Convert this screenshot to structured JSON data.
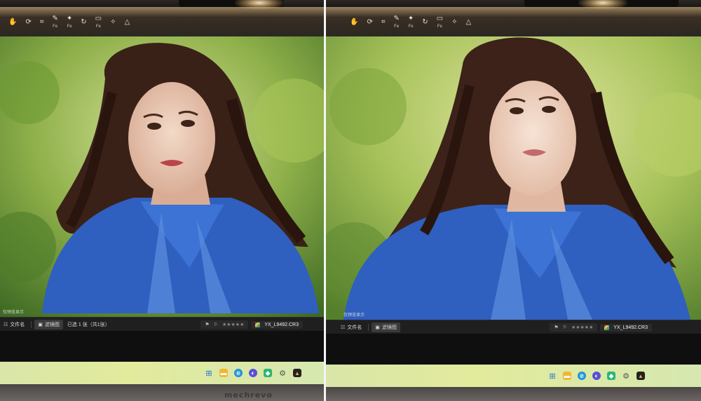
{
  "toolbar_icons": [
    {
      "icon": "hand-icon",
      "caption": ""
    },
    {
      "icon": "rotate-icon",
      "caption": ""
    },
    {
      "icon": "crop-icon",
      "caption": ""
    },
    {
      "icon": "brush-icon",
      "caption": "Fe"
    },
    {
      "icon": "wand-icon",
      "caption": "Fe"
    },
    {
      "icon": "history-icon",
      "caption": ""
    },
    {
      "icon": "frame-icon",
      "caption": "Fe"
    },
    {
      "icon": "sparkle-icon",
      "caption": ""
    },
    {
      "icon": "triangle-icon",
      "caption": ""
    }
  ],
  "overlay_hint": "仅预览显示",
  "status": {
    "filmstrip_label": "文件名",
    "tab_label": "滤镜图",
    "selection_info": "已选 1 张（共1张）",
    "rating_stars": 5,
    "filename": "YX_L9492.CR3"
  },
  "taskbar_icons": [
    "windows-start-icon",
    "folder-icon",
    "edge-icon",
    "purple-app-icon",
    "green-app-icon",
    "settings-icon",
    "photo-app-icon"
  ],
  "bezel_brand": "mechrevo",
  "colors": {
    "toolbar_warm": "#ffd696",
    "status_bg": "#1f1f1f",
    "taskbar_bg": "#dfe8a6",
    "denim": "#2f5fbf"
  }
}
